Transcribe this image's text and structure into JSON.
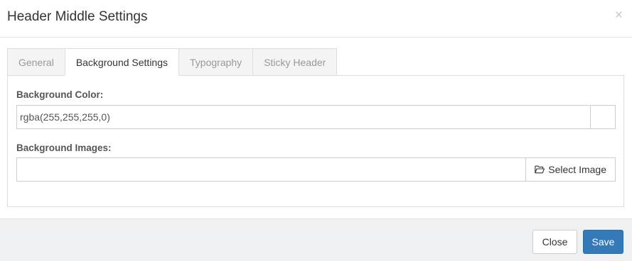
{
  "modal": {
    "title": "Header Middle Settings",
    "close_symbol": "×"
  },
  "tabs": [
    {
      "label": "General",
      "active": false
    },
    {
      "label": "Background Settings",
      "active": true
    },
    {
      "label": "Typography",
      "active": false
    },
    {
      "label": "Sticky Header",
      "active": false
    }
  ],
  "background": {
    "color_label": "Background Color:",
    "color_value": "rgba(255,255,255,0)",
    "images_label": "Background Images:",
    "images_value": "",
    "select_image_label": "Select Image",
    "select_image_icon": "folder-open-icon"
  },
  "footer": {
    "close_label": "Close",
    "save_label": "Save"
  },
  "colors": {
    "primary": "#337ab7",
    "footer_bg": "#eef0f1",
    "border": "#dddddd"
  }
}
